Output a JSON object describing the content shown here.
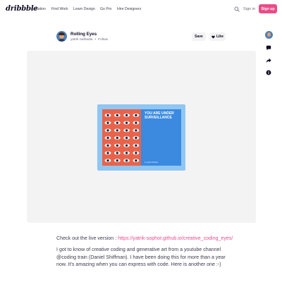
{
  "header": {
    "logo": "dribbble",
    "nav": [
      "Inspiration",
      "Find Work",
      "Learn Design",
      "Go Pro",
      "Hire Designers"
    ],
    "sign_in": "Sign in",
    "sign_up": "Sign up",
    "accent_color": "#ea4c89"
  },
  "shot": {
    "title": "Rolling Eyes",
    "author": "yatrik radhadia",
    "separator": "•",
    "follow": "Follow",
    "save_label": "Save",
    "like_label": "Like",
    "artwork": {
      "headline": "YOU ARE UNDER SURVEILLANCE",
      "credit": "by yatrik radhadia",
      "left_color": "#e8634a",
      "right_color": "#3b8ae0",
      "frame_color": "#8fc6f2"
    }
  },
  "right_rail": {
    "icons": [
      "author-avatar",
      "comment-icon",
      "share-icon",
      "info-icon"
    ]
  },
  "description": {
    "line1_prefix": "Check out the live version : ",
    "line1_link": "https://yatrik-sophot.github.io/creative_coding_eyes/",
    "paragraph": "I got to know of creative coding and generative art from a youtube channel @coding train (Daniel Shiffman). I have been doing this for more than a year now. It's amazing when you can express with code. Here is another one :-)"
  }
}
